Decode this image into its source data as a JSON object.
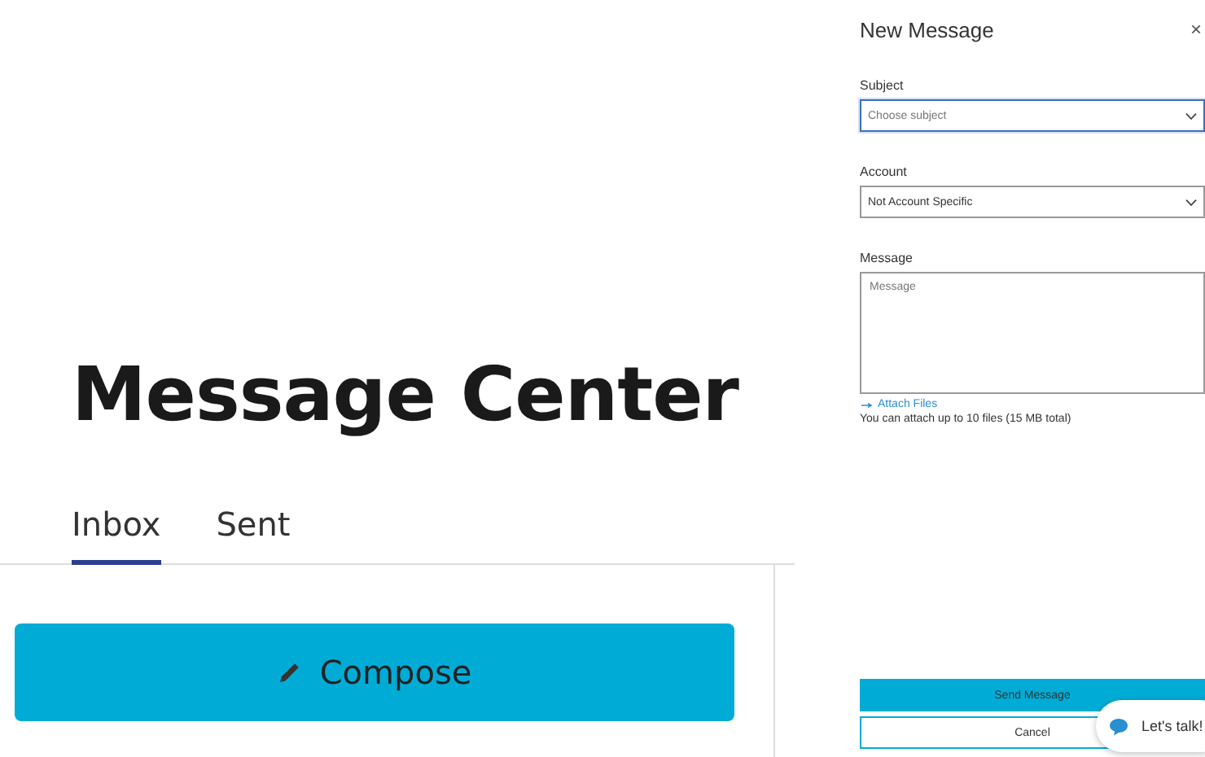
{
  "page": {
    "title": "Message Center"
  },
  "tabs": [
    {
      "label": "Inbox",
      "selected": true
    },
    {
      "label": "Sent",
      "selected": false
    }
  ],
  "compose_button": {
    "label": "Compose"
  },
  "panel": {
    "title": "New Message",
    "close": "×",
    "fields": [
      {
        "kind": "select",
        "label": "Subject",
        "placeholder": "Choose subject",
        "focused": true
      },
      {
        "kind": "select",
        "label": "Account",
        "value": "Not Account Specific",
        "focused": false
      },
      {
        "kind": "textarea",
        "label": "Message",
        "placeholder": "Message",
        "focused": false
      }
    ],
    "attach_link": "Attach Files",
    "attach_note": "You can attach up to 10 files (15 MB total)",
    "buttons": [
      {
        "kind": "primary",
        "label": "Send Message"
      },
      {
        "kind": "secondary",
        "label": "Cancel"
      }
    ]
  },
  "chat": {
    "label": "Let's talk!"
  }
}
